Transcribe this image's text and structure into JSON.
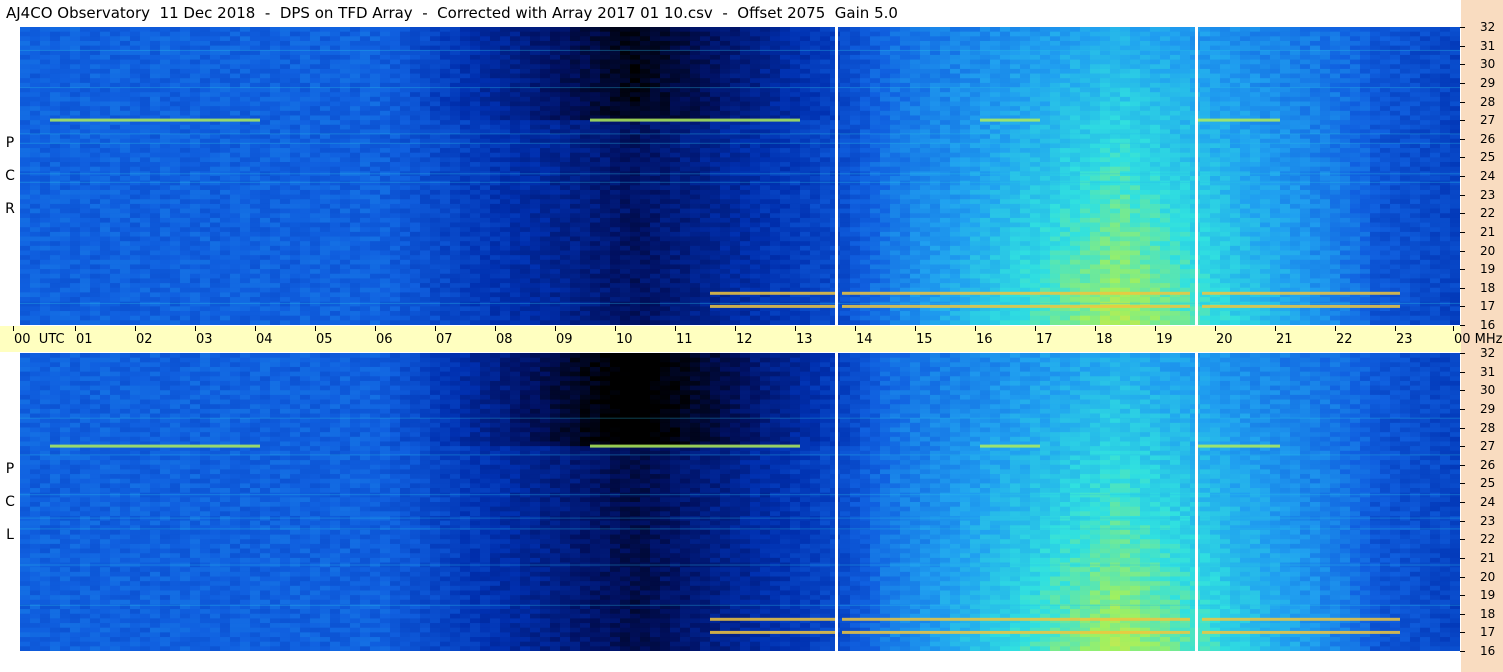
{
  "header": {
    "title": "AJ4CO Observatory  11 Dec 2018  -  DPS on TFD Array  -  Corrected with Array 2017 01 10.csv  -  Offset 2075  Gain 5.0"
  },
  "panels": {
    "top_label": [
      "R",
      "C",
      "P"
    ],
    "bottom_label": [
      "L",
      "C",
      "P"
    ]
  },
  "colors": {
    "edge_strip": "#f9dcc0",
    "axis_band": "#ffffc0",
    "colormap": [
      "#000000",
      "#001060",
      "#0030b0",
      "#1060e0",
      "#20a0f0",
      "#30e0e0",
      "#a0f060",
      "#f0e040",
      "#f06030",
      "#ff40ff",
      "#ffffff"
    ]
  },
  "chart_data": {
    "type": "heatmap",
    "title": "AJ4CO Observatory  11 Dec 2018  -  DPS on TFD Array  -  Corrected with Array 2017 01 10.csv  -  Offset 2075  Gain 5.0",
    "x_axis": {
      "unit_label": "UTC",
      "ticks": [
        "00",
        "01",
        "02",
        "03",
        "04",
        "05",
        "06",
        "07",
        "08",
        "09",
        "10",
        "11",
        "12",
        "13",
        "14",
        "15",
        "16",
        "17",
        "18",
        "19",
        "20",
        "21",
        "22",
        "23",
        "00"
      ],
      "range_hours": [
        0,
        24
      ]
    },
    "y_axis": {
      "unit_label": "MHz",
      "ticks": [
        "32",
        "31",
        "30",
        "29",
        "28",
        "27",
        "26",
        "25",
        "24",
        "23",
        "22",
        "21",
        "20",
        "19",
        "18",
        "17",
        "16"
      ],
      "range_mhz": [
        16,
        32
      ]
    },
    "series": [
      {
        "name": "R C P"
      },
      {
        "name": "L C P"
      }
    ],
    "data_gaps_hours": [
      13.6,
      19.6
    ],
    "strong_bands_mhz": [
      27.0,
      17.0,
      17.7
    ],
    "description_values": {
      "dark_period_hours": [
        7.5,
        13.0
      ],
      "bright_period_hours": [
        15.0,
        21.0
      ]
    }
  }
}
